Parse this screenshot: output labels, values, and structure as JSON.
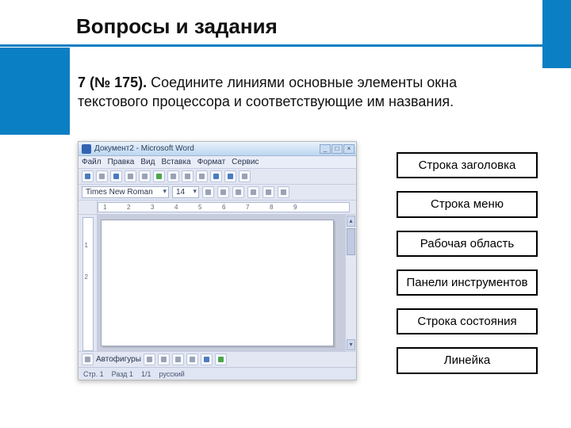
{
  "heading": "Вопросы и задания",
  "question": {
    "num": "7 (№ 175).",
    "text": " Соедините линиями основные элементы окна текстового процессора и соответствующие им названия."
  },
  "labels": [
    "Строка заголовка",
    "Строка меню",
    "Рабочая область",
    "Панели инструментов",
    "Строка состояния",
    "Линейка"
  ],
  "word": {
    "title": "Документ2 - Microsoft Word",
    "wincontrols": {
      "min": "_",
      "max": "□",
      "close": "×"
    },
    "menu": [
      "Файл",
      "Правка",
      "Вид",
      "Вставка",
      "Формат",
      "Сервис"
    ],
    "font": {
      "name": "Times New Roman",
      "size": "14"
    },
    "ruler_ticks": [
      "1",
      "2",
      "3",
      "4",
      "5",
      "6",
      "7",
      "8",
      "9"
    ],
    "vruler_ticks": [
      "1",
      "2"
    ],
    "scroll": {
      "up": "▴",
      "down": "▾"
    },
    "drawbar_label": "Автофигуры",
    "status": {
      "page": "Стр. 1",
      "sec": "Разд 1",
      "pages": "1/1",
      "lang": "русский"
    }
  }
}
